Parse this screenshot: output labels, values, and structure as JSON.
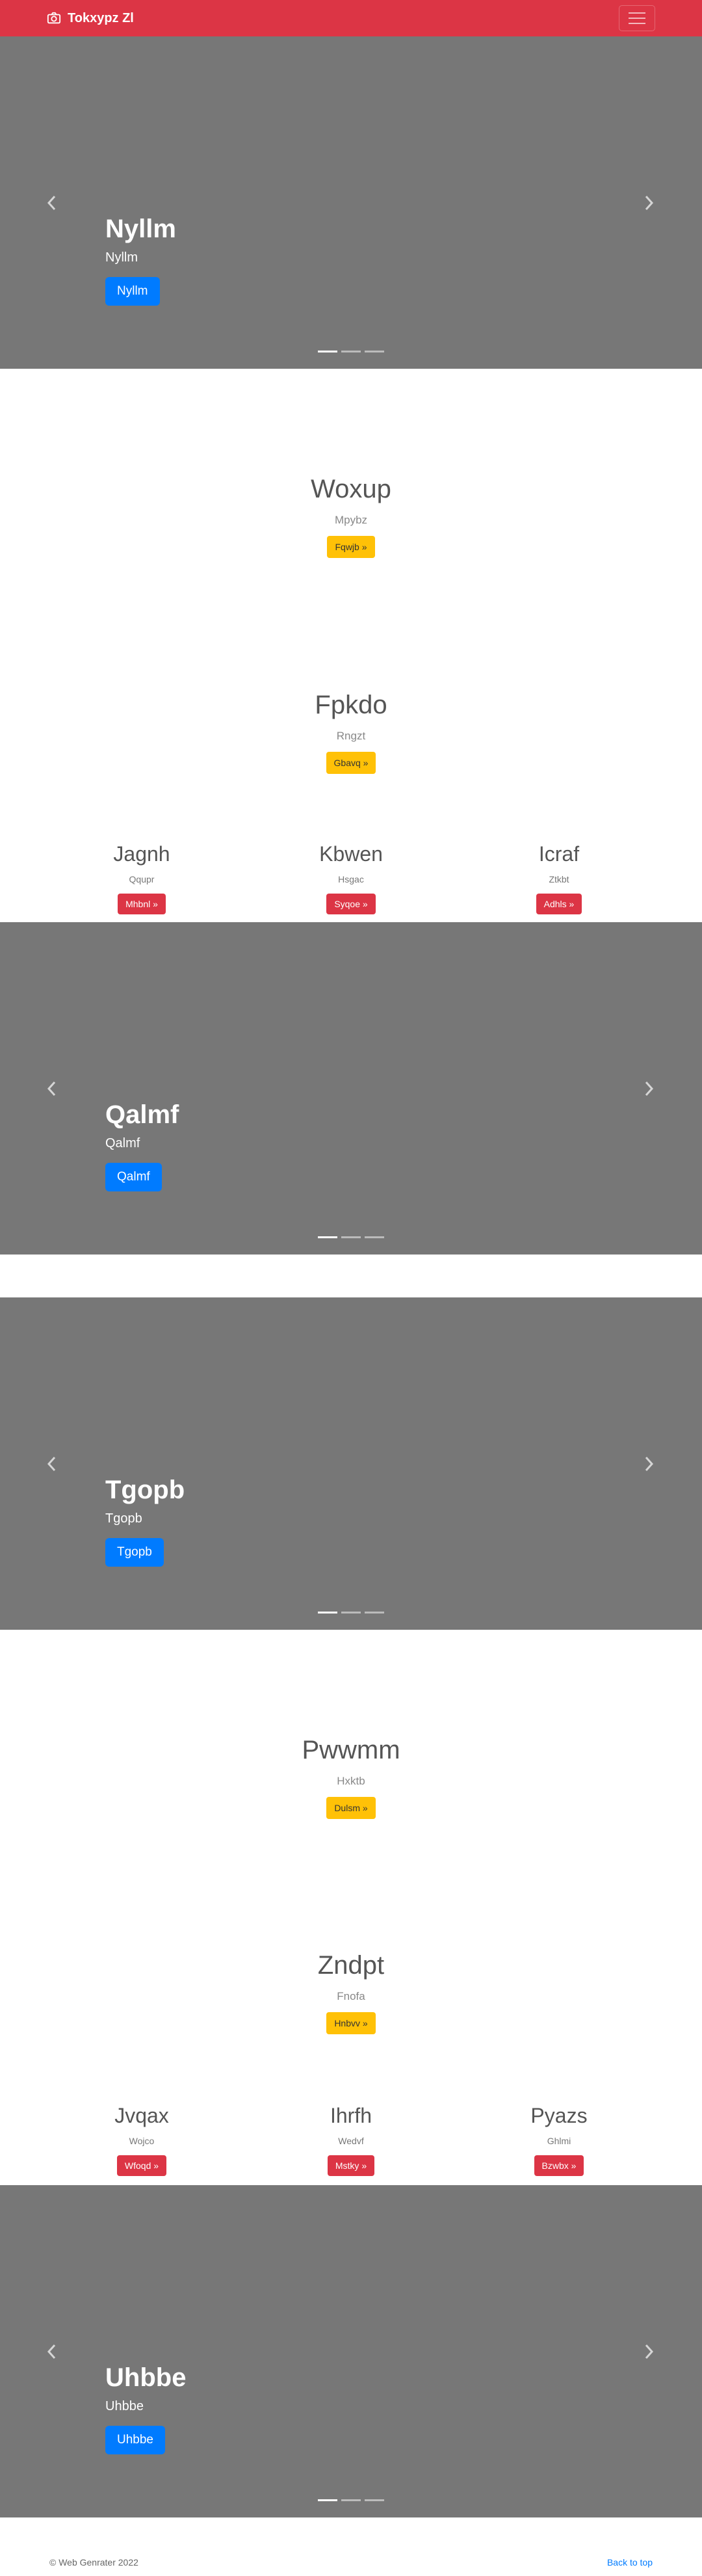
{
  "navbar": {
    "brand": "Tokxypz Zl",
    "bg_color": "#dc3545",
    "brand_icon": "camera-icon",
    "toggler_icon": "hamburger-menu-icon"
  },
  "carousels": [
    {
      "title": "Nyllm",
      "subtitle": "Nyllm",
      "button": "Nyllm"
    },
    {
      "title": "Qalmf",
      "subtitle": "Qalmf",
      "button": "Qalmf"
    },
    {
      "title": "Tgopb",
      "subtitle": "Tgopb",
      "button": "Tgopb"
    },
    {
      "title": "Uhbbe",
      "subtitle": "Uhbbe",
      "button": "Uhbbe"
    }
  ],
  "features": [
    {
      "title": "Woxup",
      "text": "Mpybz",
      "button": "Fqwjb »"
    },
    {
      "title": "Fpkdo",
      "text": "Rngzt",
      "button": "Gbavq »"
    },
    {
      "title": "Pwwmm",
      "text": "Hxktb",
      "button": "Dulsm »"
    },
    {
      "title": "Zndpt",
      "text": "Fnofa",
      "button": "Hnbvv »"
    }
  ],
  "columns_1": [
    {
      "title": "Jagnh",
      "text": "Qqupr",
      "button": "Mhbnl »"
    },
    {
      "title": "Kbwen",
      "text": "Hsgac",
      "button": "Syqoe »"
    },
    {
      "title": "Icraf",
      "text": "Ztkbt",
      "button": "Adhls »"
    }
  ],
  "columns_2": [
    {
      "title": "Jvqax",
      "text": "Wojco",
      "button": "Wfoqd »"
    },
    {
      "title": "Ihrfh",
      "text": "Wedvf",
      "button": "Mstky »"
    },
    {
      "title": "Pyazs",
      "text": "Ghlmi",
      "button": "Bzwbx »"
    }
  ],
  "footer": {
    "copyright": "© Web Genrater 2022",
    "back_to_top": "Back to top"
  },
  "colors": {
    "primary": "#007bff",
    "warning": "#ffc107",
    "danger": "#dc3545",
    "carousel_bg": "#777777"
  }
}
